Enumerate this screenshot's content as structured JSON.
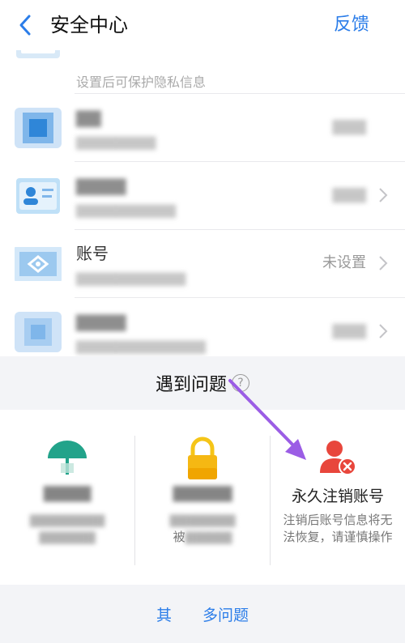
{
  "header": {
    "title": "安全中心",
    "feedback_label": "反馈",
    "back_icon": "chevron-left-icon"
  },
  "security_items": [
    {
      "name": "",
      "sub": "设置后可保护隐私信息",
      "status": ""
    },
    {
      "name": "",
      "sub": "",
      "status": ""
    },
    {
      "name": "",
      "sub": "",
      "status": ""
    },
    {
      "name": "账号",
      "sub": "",
      "status": "未设置"
    },
    {
      "name": "",
      "sub": "",
      "status": ""
    }
  ],
  "problems": {
    "title": "遇到问题",
    "help_icon": "question-circle-icon",
    "cards": [
      {
        "icon": "umbrella-icon",
        "name": "",
        "desc": ""
      },
      {
        "icon": "lock-icon",
        "name": "",
        "desc": "被"
      },
      {
        "icon": "user-delete-icon",
        "name": "永久注销账号",
        "desc": "注销后账号信息将无法恢复，请谨慎操作"
      }
    ]
  },
  "more_problems_label": "其　　多问题",
  "colors": {
    "accent": "#2b7de9",
    "danger": "#e8463c",
    "annotation_arrow": "#9b5de5"
  }
}
